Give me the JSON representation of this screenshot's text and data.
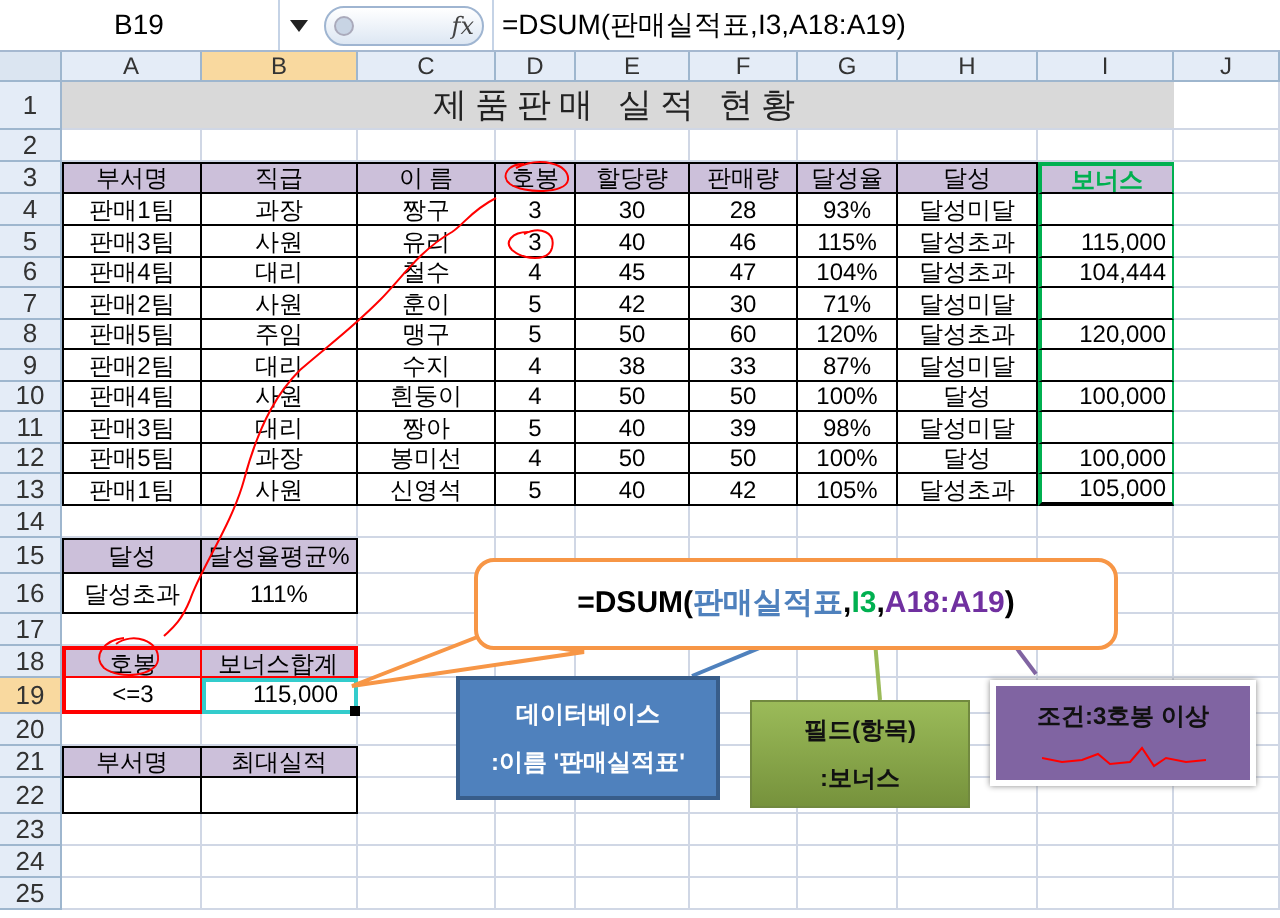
{
  "formula_bar": {
    "name_box": "B19",
    "fx": "fx",
    "formula": "=DSUM(판매실적표,I3,A18:A19)"
  },
  "columns": [
    {
      "label": "A",
      "selected": false
    },
    {
      "label": "B",
      "selected": true
    },
    {
      "label": "C",
      "selected": false
    },
    {
      "label": "D",
      "selected": false
    },
    {
      "label": "E",
      "selected": false
    },
    {
      "label": "F",
      "selected": false
    },
    {
      "label": "G",
      "selected": false
    },
    {
      "label": "H",
      "selected": false
    },
    {
      "label": "I",
      "selected": false
    },
    {
      "label": "J",
      "selected": false
    }
  ],
  "row_numbers": [
    {
      "label": "1",
      "selected": false
    },
    {
      "label": "2",
      "selected": false
    },
    {
      "label": "3",
      "selected": false
    },
    {
      "label": "4",
      "selected": false
    },
    {
      "label": "5",
      "selected": false
    },
    {
      "label": "6",
      "selected": false
    },
    {
      "label": "7",
      "selected": false
    },
    {
      "label": "8",
      "selected": false
    },
    {
      "label": "9",
      "selected": false
    },
    {
      "label": "10",
      "selected": false
    },
    {
      "label": "11",
      "selected": false
    },
    {
      "label": "12",
      "selected": false
    },
    {
      "label": "13",
      "selected": false
    },
    {
      "label": "14",
      "selected": false
    },
    {
      "label": "15",
      "selected": false
    },
    {
      "label": "16",
      "selected": false
    },
    {
      "label": "17",
      "selected": false
    },
    {
      "label": "18",
      "selected": false
    },
    {
      "label": "19",
      "selected": true
    },
    {
      "label": "20",
      "selected": false
    },
    {
      "label": "21",
      "selected": false
    },
    {
      "label": "22",
      "selected": false
    },
    {
      "label": "23",
      "selected": false
    },
    {
      "label": "24",
      "selected": false
    },
    {
      "label": "25",
      "selected": false
    }
  ],
  "sheet": {
    "title": "제품판매 실적 현황",
    "table": {
      "columns": [
        "부서명",
        "직급",
        "이 름",
        "호봉",
        "할당량",
        "판매량",
        "달성율",
        "달성",
        "보너스"
      ],
      "rows": [
        {
          "cells": [
            "판매1팀",
            "과장",
            "짱구",
            "3",
            "30",
            "28",
            "93%",
            "달성미달"
          ]
        },
        {
          "cells": [
            "판매3팀",
            "사원",
            "유리",
            "3",
            "40",
            "46",
            "115%",
            "달성초과"
          ],
          "bonus": "115,000"
        },
        {
          "cells": [
            "판매4팀",
            "대리",
            "철수",
            "4",
            "45",
            "47",
            "104%",
            "달성초과"
          ],
          "bonus": "104,444"
        },
        {
          "cells": [
            "판매2팀",
            "사원",
            "훈이",
            "5",
            "42",
            "30",
            "71%",
            "달성미달"
          ]
        },
        {
          "cells": [
            "판매5팀",
            "주임",
            "맹구",
            "5",
            "50",
            "60",
            "120%",
            "달성초과"
          ],
          "bonus": "120,000"
        },
        {
          "cells": [
            "판매2팀",
            "대리",
            "수지",
            "4",
            "38",
            "33",
            "87%",
            "달성미달"
          ]
        },
        {
          "cells": [
            "판매4팀",
            "사원",
            "흰둥이",
            "4",
            "50",
            "50",
            "100%",
            "달성"
          ],
          "bonus": "100,000"
        },
        {
          "cells": [
            "판매3팀",
            "대리",
            "짱아",
            "5",
            "40",
            "39",
            "98%",
            "달성미달"
          ]
        },
        {
          "cells": [
            "판매5팀",
            "과장",
            "봉미선",
            "4",
            "50",
            "50",
            "100%",
            "달성"
          ],
          "bonus": "100,000"
        },
        {
          "cells": [
            "판매1팀",
            "사원",
            "신영석",
            "5",
            "40",
            "42",
            "105%",
            "달성초과"
          ],
          "bonus": "105,000"
        }
      ]
    },
    "summary": {
      "headers": [
        "달성",
        "달성율평균%"
      ],
      "values": [
        "달성초과",
        "111%"
      ]
    },
    "criteria": {
      "headers": [
        "호봉",
        "보너스합계"
      ],
      "values": [
        "<=3",
        "115,000"
      ]
    },
    "max_table": {
      "headers": [
        "부서명",
        "최대실적"
      ]
    }
  },
  "callout": {
    "parts": [
      {
        "text": "=DSUM(",
        "color": "#000000"
      },
      {
        "text": "판매실적표",
        "color": "#4f81bd"
      },
      {
        "text": ",",
        "color": "#000000"
      },
      {
        "text": "I3",
        "color": "#00b050"
      },
      {
        "text": ",",
        "color": "#000000"
      },
      {
        "text": "A18:A19",
        "color": "#7030a0"
      },
      {
        "text": ")",
        "color": "#000000"
      }
    ]
  },
  "notes": [
    {
      "kind": "database",
      "color": "#4f81bd",
      "lines": [
        "데이터베이스",
        ":이름 '판매실적표'"
      ]
    },
    {
      "kind": "field",
      "color": "#9bbb59",
      "lines": [
        "필드(항목)",
        ":보너스"
      ]
    },
    {
      "kind": "criteria",
      "color": "#8064a2",
      "lines": [
        "조건:3호봉 이상"
      ]
    }
  ]
}
